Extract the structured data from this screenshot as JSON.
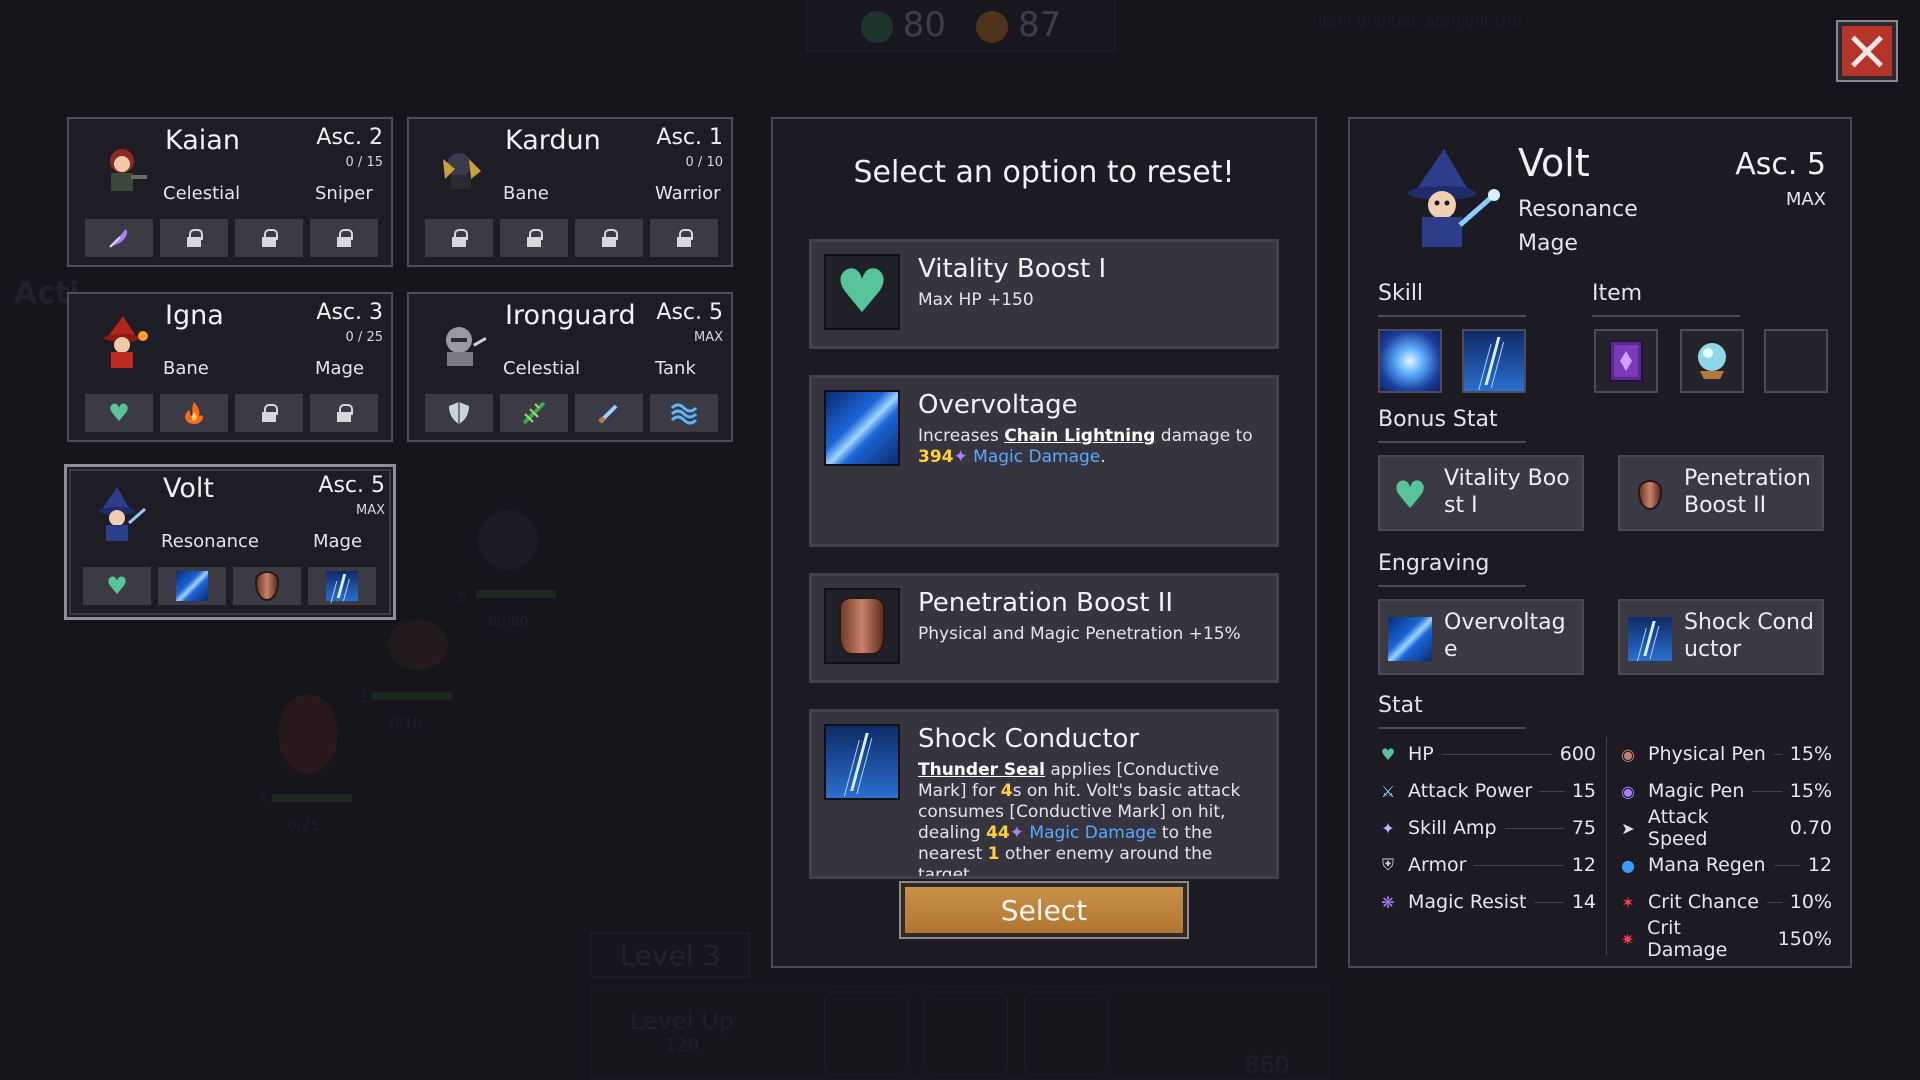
{
  "hud": {
    "hp_value": "80",
    "gold_value": "87",
    "toast": "Item granted: Starlight Orb",
    "actions_label": "Acti",
    "level_label": "Level 3",
    "level_up_label": "Level Up",
    "level_up_cost": "120",
    "soul_value": "860",
    "bg_hp1": "80/80",
    "bg_hp2": "0/10",
    "bg_hp3": "0/25",
    "bg_lv5": "5",
    "bg_lv1": "1",
    "bg_lv3": "3"
  },
  "heroes": [
    {
      "name": "Kaian",
      "asc": "Asc. 2",
      "progress": "0 / 15",
      "trait1": "Celestial",
      "trait2": "Sniper"
    },
    {
      "name": "Kardun",
      "asc": "Asc. 1",
      "progress": "0 / 10",
      "trait1": "Bane",
      "trait2": "Warrior"
    },
    {
      "name": "Igna",
      "asc": "Asc. 3",
      "progress": "0 / 25",
      "trait1": "Bane",
      "trait2": "Mage"
    },
    {
      "name": "Ironguard",
      "asc": "Asc. 5",
      "progress": "MAX",
      "trait1": "Celestial",
      "trait2": "Tank"
    },
    {
      "name": "Volt",
      "asc": "Asc. 5",
      "progress": "MAX",
      "trait1": "Resonance",
      "trait2": "Mage"
    }
  ],
  "reset": {
    "title": "Select an option to reset!",
    "options": [
      {
        "title": "Vitality Boost I",
        "desc": "Max HP +150"
      },
      {
        "title": "Overvoltage",
        "desc_pre": "Increases ",
        "desc_skill": "Chain Lightning",
        "desc_mid": " damage to ",
        "desc_num": "394",
        "desc_dmg": "Magic Damage",
        "desc_end": "."
      },
      {
        "title": "Penetration Boost II",
        "desc": "Physical and Magic Penetration +15%"
      },
      {
        "title": "Shock Conductor",
        "desc_skill": "Thunder Seal",
        "desc_a": " applies [Conductive Mark] for ",
        "desc_sec": "4",
        "desc_b": "s on hit. Volt's basic attack consumes [Conductive Mark] on hit, dealing ",
        "desc_num": "44",
        "desc_dmg": "Magic Damage",
        "desc_c": " to the nearest ",
        "desc_count": "1",
        "desc_d": " other enemy around the target."
      }
    ],
    "select_label": "Select"
  },
  "detail": {
    "name": "Volt",
    "trait1": "Resonance",
    "trait2": "Mage",
    "asc": "Asc. 5",
    "max": "MAX",
    "skill_header": "Skill",
    "item_header": "Item",
    "bonus_header": "Bonus Stat",
    "engraving_header": "Engraving",
    "stat_header": "Stat",
    "bonus": [
      "Vitality Boost I",
      "Penetration Boost II"
    ],
    "engraving": [
      "Overvoltage",
      "Shock Conductor"
    ],
    "stats_left": [
      {
        "label": "HP",
        "value": "600"
      },
      {
        "label": "Attack Power",
        "value": "15"
      },
      {
        "label": "Skill Amp",
        "value": "75"
      },
      {
        "label": "Armor",
        "value": "12"
      },
      {
        "label": "Magic Resist",
        "value": "14"
      }
    ],
    "stats_right": [
      {
        "label": "Physical Pen",
        "value": "15%"
      },
      {
        "label": "Magic Pen",
        "value": "15%"
      },
      {
        "label": "Attack Speed",
        "value": "0.70"
      },
      {
        "label": "Mana Regen",
        "value": "12"
      },
      {
        "label": "Crit Chance",
        "value": "10%"
      },
      {
        "label": "Crit Damage",
        "value": "150%"
      }
    ]
  },
  "colors": {
    "accent_gold": "#ffd23c",
    "magic_blue": "#5aa8ff",
    "heart_green": "#58c49a",
    "close_red": "#b5352b"
  }
}
